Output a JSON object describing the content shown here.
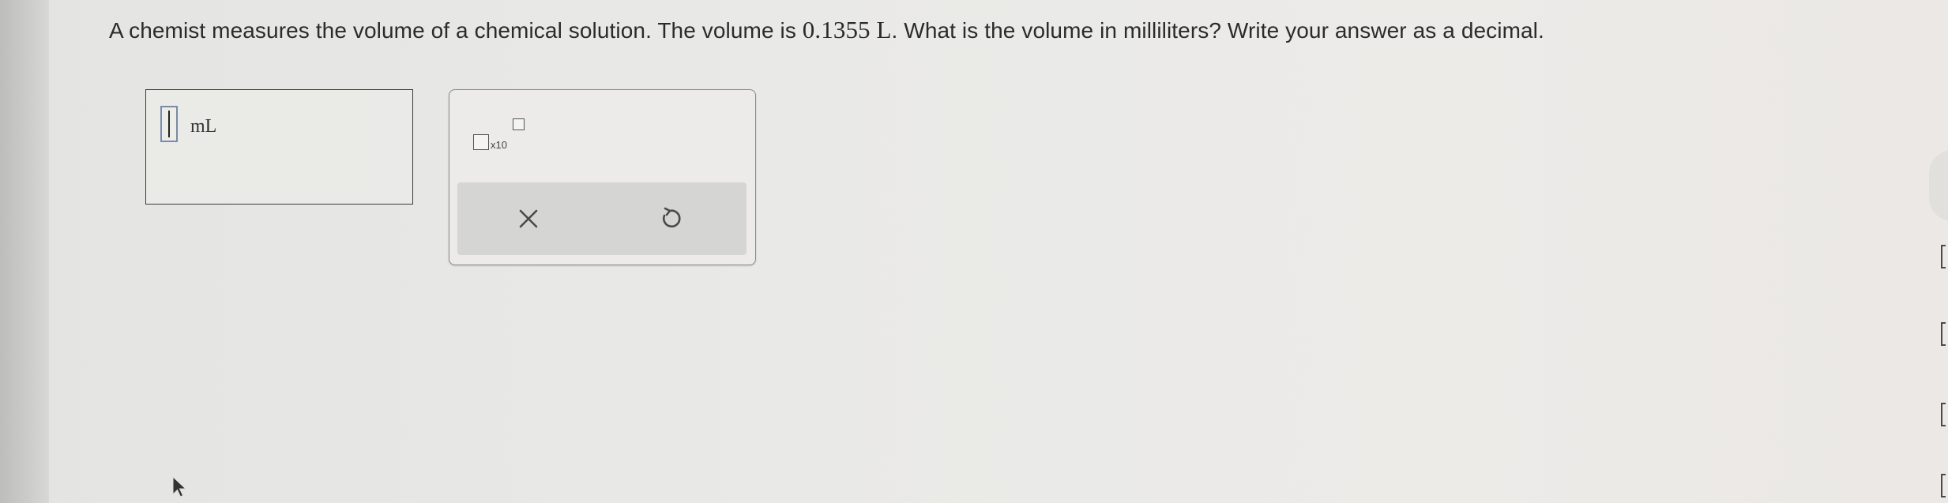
{
  "question": {
    "text_before": "A chemist measures the volume of a chemical solution. The volume is ",
    "value": "0.1355 L",
    "text_after": ". What is the volume in milliliters? Write your answer as a decimal."
  },
  "answer": {
    "value": "",
    "unit": "mL"
  },
  "toolbox": {
    "sci_notation_label": "x10",
    "icons": {
      "clear": "close-icon",
      "undo": "undo-icon"
    }
  },
  "colors": {
    "input_border": "#7a8aa8",
    "action_bar": "#d5d5d4"
  }
}
